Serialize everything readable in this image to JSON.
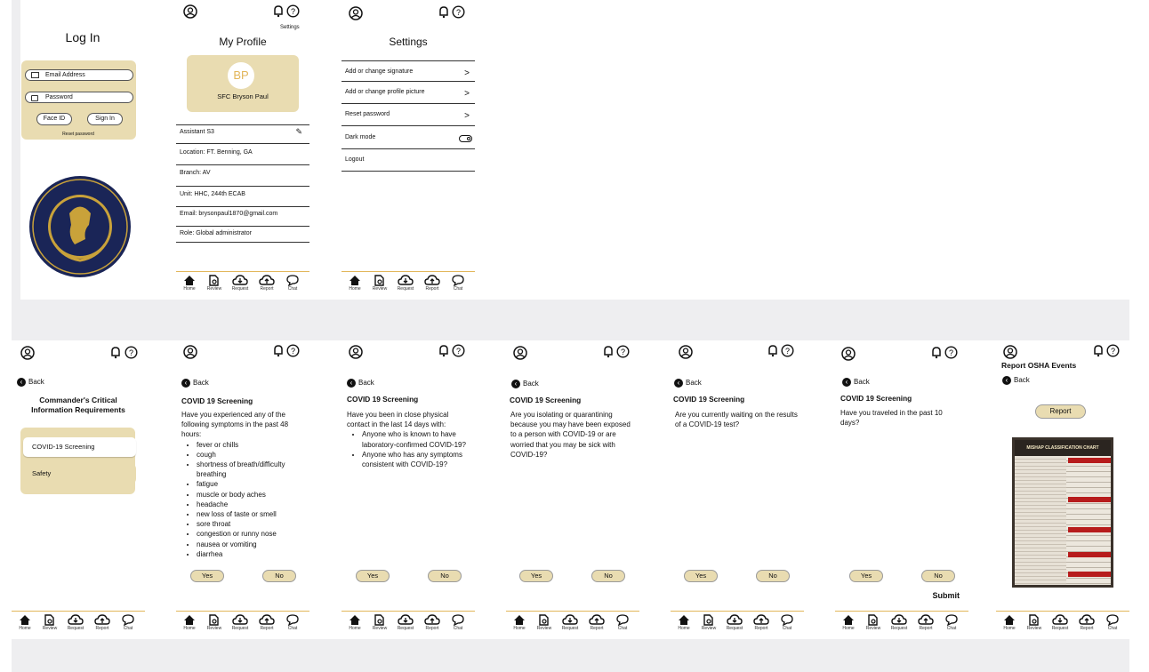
{
  "login": {
    "title": "Log In",
    "email_placeholder": "Email Address",
    "password_placeholder": "Password",
    "faceid_label": "Face ID",
    "signin_label": "Sign In",
    "reset_label": "Reset password",
    "seal_text": "UNITED STATES ARMY RESERVE"
  },
  "profile": {
    "settings_label": "Settings",
    "title": "My Profile",
    "initials": "BP",
    "name": "SFC Bryson Paul",
    "rows": [
      "Assistant S3",
      "Location: FT. Benning, GA",
      "Branch: AV",
      "Unit: HHC, 244th ECAB",
      "Email: brysonpaul1870@gmail.com",
      "Role: Global administrator"
    ]
  },
  "settings": {
    "title": "Settings",
    "items": [
      "Add or change signature",
      "Add or change profile picture",
      "Reset password",
      "Dark mode",
      "Logout"
    ]
  },
  "nav": {
    "home": "Home",
    "review": "Review",
    "request": "Request",
    "report": "Report",
    "chat": "Chat"
  },
  "common": {
    "back": "Back",
    "yes": "Yes",
    "no": "No",
    "submit": "Submit"
  },
  "ccir": {
    "title_line1": "Commander's Critical",
    "title_line2": "Information Requirements",
    "opt1": "COVID-19 Screening",
    "opt2": "Safety"
  },
  "covid": {
    "title": "COVID 19 Screening",
    "q1_intro": "Have you experienced any of the following symptoms in the past 48 hours:",
    "q1_items": [
      "fever or chills",
      "cough",
      "shortness of breath/difficulty breathing",
      "fatigue",
      "muscle or body aches",
      "headache",
      "new loss of taste or smell",
      "sore throat",
      "congestion or runny nose",
      "nausea or vomiting",
      "diarrhea"
    ],
    "q2_intro": "Have you been in close physical contact in the last 14 days with:",
    "q2_items": [
      "Anyone who is known to have laboratory-confirmed COVID-19?",
      "Anyone who has any symptoms consistent with COVID-19?"
    ],
    "q3": "Are you isolating or quarantining because you may have been exposed to a person with COVID-19 or are worried that you may be sick with COVID-19?",
    "q4": "Are you currently waiting on the results of a COVID-19 test?",
    "q5": "Have you traveled in the past 10 days?"
  },
  "osha": {
    "title": "Report OSHA Events",
    "report_label": "Report",
    "chart_title": "MISHAP CLASSIFICATION CHART"
  },
  "colors": {
    "accent": "#e9dcb1",
    "divider": "#e2b65a",
    "strip": "#eeeef0",
    "seal_navy": "#1a2557",
    "seal_gold": "#c9a23a"
  }
}
